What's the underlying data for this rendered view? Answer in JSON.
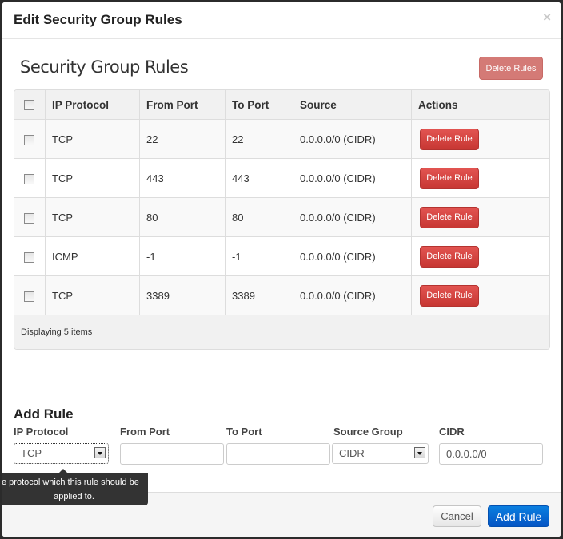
{
  "modal": {
    "title": "Edit Security Group Rules",
    "close_glyph": "×"
  },
  "rules_section": {
    "title": "Security Group Rules",
    "delete_rules_label": "Delete Rules",
    "columns": [
      "IP Protocol",
      "From Port",
      "To Port",
      "Source",
      "Actions"
    ],
    "rows": [
      {
        "protocol": "TCP",
        "from_port": "22",
        "to_port": "22",
        "source": "0.0.0.0/0 (CIDR)",
        "action": "Delete Rule"
      },
      {
        "protocol": "TCP",
        "from_port": "443",
        "to_port": "443",
        "source": "0.0.0.0/0 (CIDR)",
        "action": "Delete Rule"
      },
      {
        "protocol": "TCP",
        "from_port": "80",
        "to_port": "80",
        "source": "0.0.0.0/0 (CIDR)",
        "action": "Delete Rule"
      },
      {
        "protocol": "ICMP",
        "from_port": "-1",
        "to_port": "-1",
        "source": "0.0.0.0/0 (CIDR)",
        "action": "Delete Rule"
      },
      {
        "protocol": "TCP",
        "from_port": "3389",
        "to_port": "3389",
        "source": "0.0.0.0/0 (CIDR)",
        "action": "Delete Rule"
      }
    ],
    "footer": "Displaying 5 items"
  },
  "add_rule": {
    "title": "Add Rule",
    "labels": {
      "ip_protocol": "IP Protocol",
      "from_port": "From Port",
      "to_port": "To Port",
      "source_group": "Source Group",
      "cidr": "CIDR"
    },
    "ip_protocol_value": "TCP",
    "from_port_value": "",
    "to_port_value": "",
    "source_group_value": "CIDR",
    "cidr_value": "0.0.0.0/0",
    "tooltip_line1": "The protocol which this rule should be",
    "tooltip_line2": "applied to."
  },
  "footer": {
    "cancel_label": "Cancel",
    "add_rule_label": "Add Rule"
  }
}
